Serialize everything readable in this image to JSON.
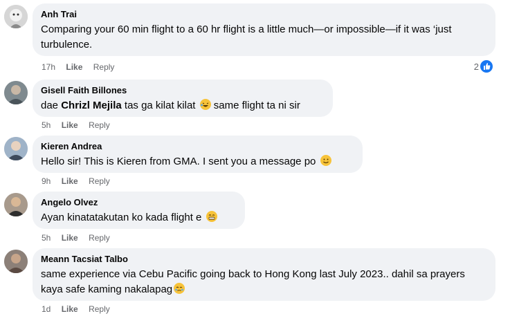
{
  "comments": [
    {
      "name": "Anh Trai",
      "text": "Comparing your 60 min flight to a 60 hr flight is a little much—or impossible—if it was ‘just turbulence.",
      "time": "17h",
      "like": "Like",
      "reply": "Reply",
      "reaction_count": "2",
      "reaction_icon": "like-icon"
    },
    {
      "name": "Gisell Faith Billones",
      "text_before": "dae ",
      "mention": "Chrizl Mejila",
      "text_after": " tas ga kilat kilat",
      "emoji": "laughing-emoji",
      "text_tail": " same flight ta ni sir",
      "time": "5h",
      "like": "Like",
      "reply": "Reply"
    },
    {
      "name": "Kieren Andrea",
      "text": "Hello sir! This is Kieren from GMA. I sent you a message po",
      "emoji": "smiling-emoji",
      "time": "9h",
      "like": "Like",
      "reply": "Reply"
    },
    {
      "name": "Angelo Olvez",
      "text": "Ayan kinatatakutan ko kada flight e",
      "emoji": "grimacing-emoji",
      "time": "5h",
      "like": "Like",
      "reply": "Reply"
    },
    {
      "name": "Meann Tacsiat Talbo",
      "text": "same experience via Cebu Pacific going back to Hong Kong last July 2023.. dahil sa prayers kaya safe kaming nakalapag",
      "emoji": "teary-emoji",
      "time": "1d",
      "like": "Like",
      "reply": "Reply"
    }
  ]
}
